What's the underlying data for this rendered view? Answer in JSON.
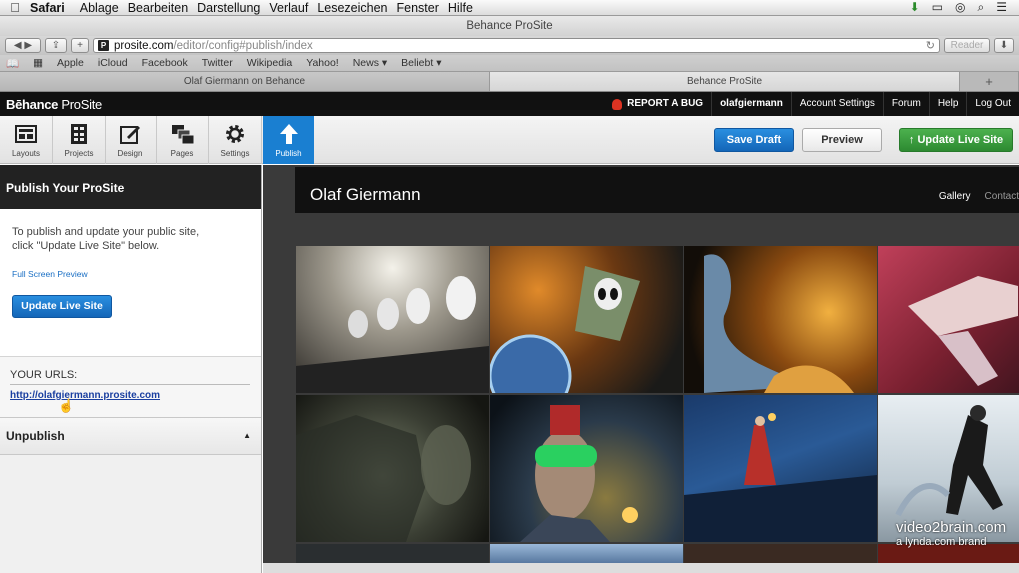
{
  "menubar": {
    "app": "Safari",
    "items": [
      "Ablage",
      "Bearbeiten",
      "Darstellung",
      "Verlauf",
      "Lesezeichen",
      "Fenster",
      "Hilfe"
    ]
  },
  "window": {
    "title": "Behance ProSite"
  },
  "toolbar": {
    "url_host": "prosite.com",
    "url_path": "/editor/config#publish/index",
    "reader_label": "Reader"
  },
  "bookmarks": [
    "Apple",
    "iCloud",
    "Facebook",
    "Twitter",
    "Wikipedia",
    "Yahoo!",
    "News ▾",
    "Beliebt ▾"
  ],
  "tabs": [
    {
      "label": "Olaf Giermann on Behance"
    },
    {
      "label": "Behance ProSite"
    }
  ],
  "behance_bar": {
    "logo_bold": "Bēhance",
    "logo_light": " ProSite",
    "report_bug": "REPORT A BUG",
    "username": "olafgiermann",
    "links": [
      "Account Settings",
      "Forum",
      "Help",
      "Log Out"
    ]
  },
  "editor_tools": [
    {
      "label": "Layouts",
      "icon": "layouts-icon"
    },
    {
      "label": "Projects",
      "icon": "projects-icon"
    },
    {
      "label": "Design",
      "icon": "design-icon"
    },
    {
      "label": "Pages",
      "icon": "pages-icon"
    },
    {
      "label": "Settings",
      "icon": "gear-icon"
    },
    {
      "label": "Publish",
      "icon": "upload-arrow-icon"
    }
  ],
  "actions": {
    "save_draft": "Save Draft",
    "preview": "Preview",
    "update_live": "Update Live Site"
  },
  "sidebar": {
    "title": "Publish Your ProSite",
    "intro": "To publish and update your public site, click \"Update Live Site\" below.",
    "fullscreen_link": "Full Screen Preview",
    "update_button": "Update Live Site",
    "urls_label": "YOUR URLS:",
    "url": "http://olafgiermann.prosite.com",
    "unpublish": "Unpublish"
  },
  "site_preview": {
    "title": "Olaf Giermann",
    "nav": [
      "Gallery",
      "Contact"
    ]
  },
  "watermark": {
    "line1": "video2brain.com",
    "line2": "a lynda.com brand"
  },
  "colors": {
    "accent_blue": "#1a7fd1",
    "update_green": "#2d8a31",
    "bar_black": "#111111"
  }
}
